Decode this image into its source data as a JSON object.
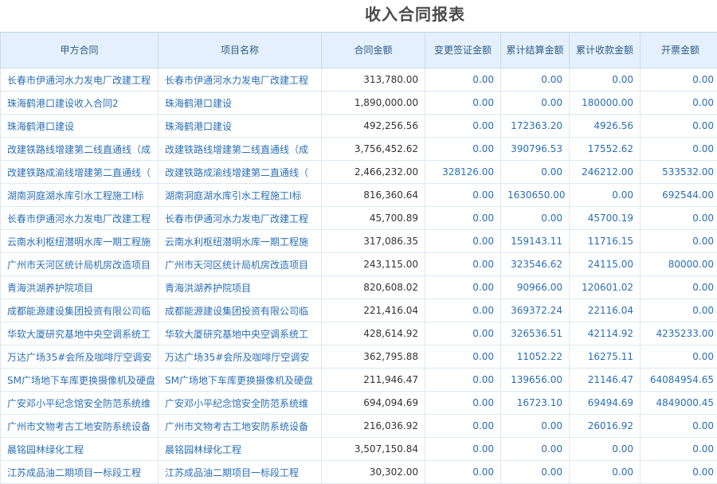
{
  "report": {
    "title": "收入合同报表"
  },
  "columns": [
    "甲方合同",
    "项目名称",
    "合同金额",
    "变更签证金额",
    "累计结算金额",
    "累计收款金额",
    "开票金额"
  ],
  "rows": [
    [
      "长春市伊通河水力发电厂改建工程",
      "长春市伊通河水力发电厂改建工程",
      "313,780.00",
      "0.00",
      "0.00",
      "0.00",
      "0.00"
    ],
    [
      "珠海鹤港口建设收入合同2",
      "珠海鹤港口建设",
      "1,890,000.00",
      "0.00",
      "0.00",
      "180000.00",
      "0.00"
    ],
    [
      "珠海鹤港口建设",
      "珠海鹤港口建设",
      "492,256.56",
      "0.00",
      "172363.20",
      "4926.56",
      "0.00"
    ],
    [
      "改建铁路线增建第二线直通线（成",
      "改建铁路线增建第二线直通线（成",
      "3,756,452.62",
      "0.00",
      "390796.53",
      "17552.62",
      "0.00"
    ],
    [
      "改建铁路成渝线增建第二直通线（",
      "改建铁路成渝线增建第二直通线（",
      "2,466,232.00",
      "328126.00",
      "0.00",
      "246212.00",
      "533532.00"
    ],
    [
      "湖南洞庭湖水库引水工程施工I标",
      "湖南洞庭湖水库引水工程施工I标",
      "816,360.64",
      "0.00",
      "1630650.00",
      "0.00",
      "692544.00"
    ],
    [
      "长春市伊通河水力发电厂改建工程",
      "长春市伊通河水力发电厂改建工程",
      "45,700.89",
      "0.00",
      "0.00",
      "45700.19",
      "0.00"
    ],
    [
      "云南水利枢纽潜明水库一期工程施",
      "云南水利枢纽潜明水库一期工程施",
      "317,086.35",
      "0.00",
      "159143.11",
      "11716.15",
      "0.00"
    ],
    [
      "广州市天河区统计局机房改造项目",
      "广州市天河区统计局机房改造项目",
      "243,115.00",
      "0.00",
      "323546.62",
      "24115.00",
      "80000.00"
    ],
    [
      "青海洪湖养护院项目",
      "青海洪湖养护院项目",
      "820,608.02",
      "0.00",
      "90966.00",
      "120601.02",
      "0.00"
    ],
    [
      "成都能源建设集团投资有限公司临",
      "成都能源建设集团投资有限公司临",
      "221,416.04",
      "0.00",
      "369372.24",
      "22116.04",
      "0.00"
    ],
    [
      "华软大厦研究基地中央空调系统工",
      "华软大厦研究基地中央空调系统工",
      "428,614.92",
      "0.00",
      "326536.51",
      "42114.92",
      "4235233.00"
    ],
    [
      "万达广场35#会所及咖啡厅空调安",
      "万达广场35#会所及咖啡厅空调安",
      "362,795.88",
      "0.00",
      "11052.22",
      "16275.11",
      "0.00"
    ],
    [
      "SM广场地下车库更换摄像机及硬盘",
      "SM广场地下车库更换摄像机及硬盘",
      "211,946.47",
      "0.00",
      "139656.00",
      "21146.47",
      "64084954.65"
    ],
    [
      "广安邓小平纪念馆安全防范系统维",
      "广安邓小平纪念馆安全防范系统维",
      "694,094.69",
      "0.00",
      "16723.10",
      "69494.69",
      "4849000.45"
    ],
    [
      "广州市文物考古工地安防系统设备",
      "广州市文物考古工地安防系统设备",
      "216,036.92",
      "0.00",
      "0.00",
      "26016.92",
      "0.00"
    ],
    [
      "晨铭园林绿化工程",
      "晨铭园林绿化工程",
      "3,507,150.84",
      "0.00",
      "0.00",
      "0.00",
      "0.00"
    ],
    [
      "江苏成品油二期项目一标段工程",
      "江苏成品油二期项目一标段工程",
      "30,302.00",
      "0.00",
      "0.00",
      "0.00",
      "0.00"
    ]
  ]
}
